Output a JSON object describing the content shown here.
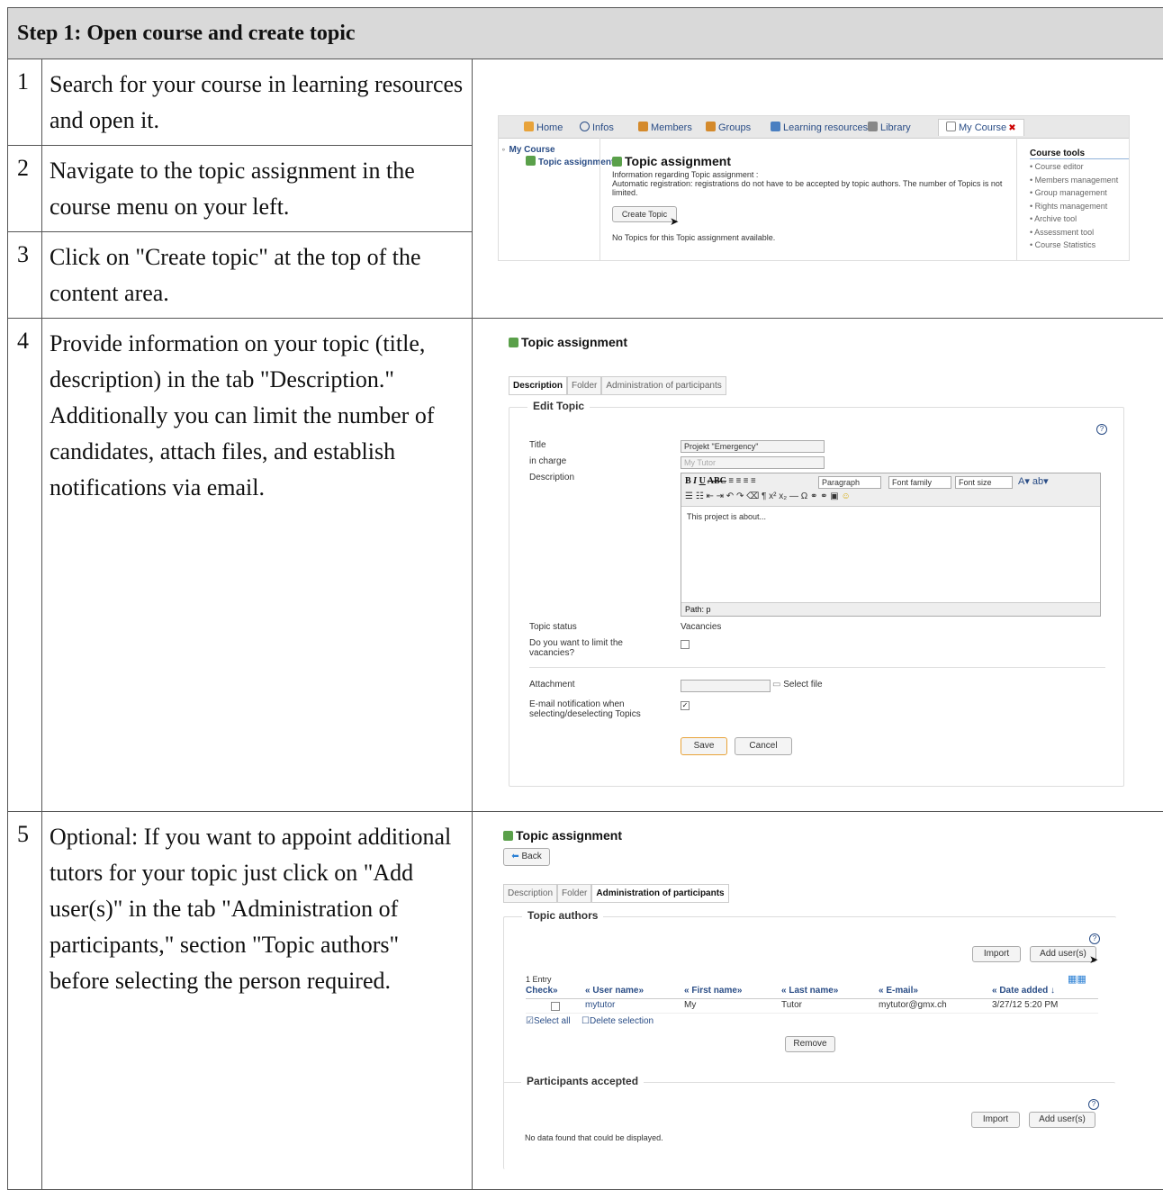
{
  "header": "Step 1: Open course and create topic",
  "steps": [
    {
      "num": "1",
      "text": "Search for your course in learning resources and open it."
    },
    {
      "num": "2",
      "text": "Navigate to the topic assignment in the course menu on your left."
    },
    {
      "num": "3",
      "text": "Click on \"Create topic\" at the top of the content area."
    },
    {
      "num": "4",
      "text": "Provide information on your topic (title, description) in the tab \"Description.\" Additionally you can limit the number of candidates, attach files, and establish notifications via email."
    },
    {
      "num": "5",
      "text": "Optional: If you want to appoint additional tutors for your topic just click on \"Add user(s)\" in the tab \"Administration of participants,\" section \"Topic authors\" before selecting the person required."
    }
  ],
  "shot1": {
    "tabs": [
      "Home",
      "Infos",
      "Members",
      "Groups",
      "Learning resources",
      "Library",
      "My Course"
    ],
    "tree_root": "My Course",
    "tree_child": "Topic assignment",
    "title": "Topic assignment",
    "info_line1": "Information regarding Topic assignment :",
    "info_line2": "Automatic registration: registrations do not have to be accepted by topic authors. The number of Topics is not",
    "info_line3": "limited.",
    "create_button": "Create Topic",
    "no_topics": "No Topics for this Topic assignment available.",
    "tools_title": "Course tools",
    "tools": [
      "Course editor",
      "Members management",
      "Group management",
      "Rights management",
      "Archive tool",
      "Assessment tool",
      "Course Statistics"
    ]
  },
  "shot2": {
    "title": "Topic assignment",
    "tabs": [
      "Description",
      "Folder",
      "Administration of participants"
    ],
    "legend": "Edit Topic",
    "title_label": "Title",
    "title_value": "Projekt \"Emergency\"",
    "incharge_label": "in charge",
    "incharge_value": "My Tutor",
    "desc_label": "Description",
    "editor_paragraph": "Paragraph",
    "editor_fontfamily": "Font family",
    "editor_fontsize": "Font size",
    "editor_content": "This project is about...",
    "editor_path": "Path: p",
    "status_label": "Topic status",
    "status_value": "Vacancies",
    "limit_label": "Do you want to limit the vacancies?",
    "attachment_label": "Attachment",
    "select_file": "Select file",
    "email_label": "E-mail notification when selecting/deselecting Topics",
    "save": "Save",
    "cancel": "Cancel"
  },
  "shot3": {
    "title": "Topic assignment",
    "back": "Back",
    "tabs": [
      "Description",
      "Folder",
      "Administration of participants"
    ],
    "authors_legend": "Topic authors",
    "import": "Import",
    "add_users": "Add user(s)",
    "entry_count": "1 Entry",
    "columns": [
      "Check»",
      "« User name»",
      "« First name»",
      "« Last name»",
      "« E-mail»",
      "« Date added ↓"
    ],
    "row": [
      "mytutor",
      "My",
      "Tutor",
      "mytutor@gmx.ch",
      "3/27/12 5:20 PM"
    ],
    "select_all": "Select all",
    "delete_selection": "Delete selection",
    "remove": "Remove",
    "participants_legend": "Participants accepted",
    "no_data": "No data found that could be displayed."
  }
}
